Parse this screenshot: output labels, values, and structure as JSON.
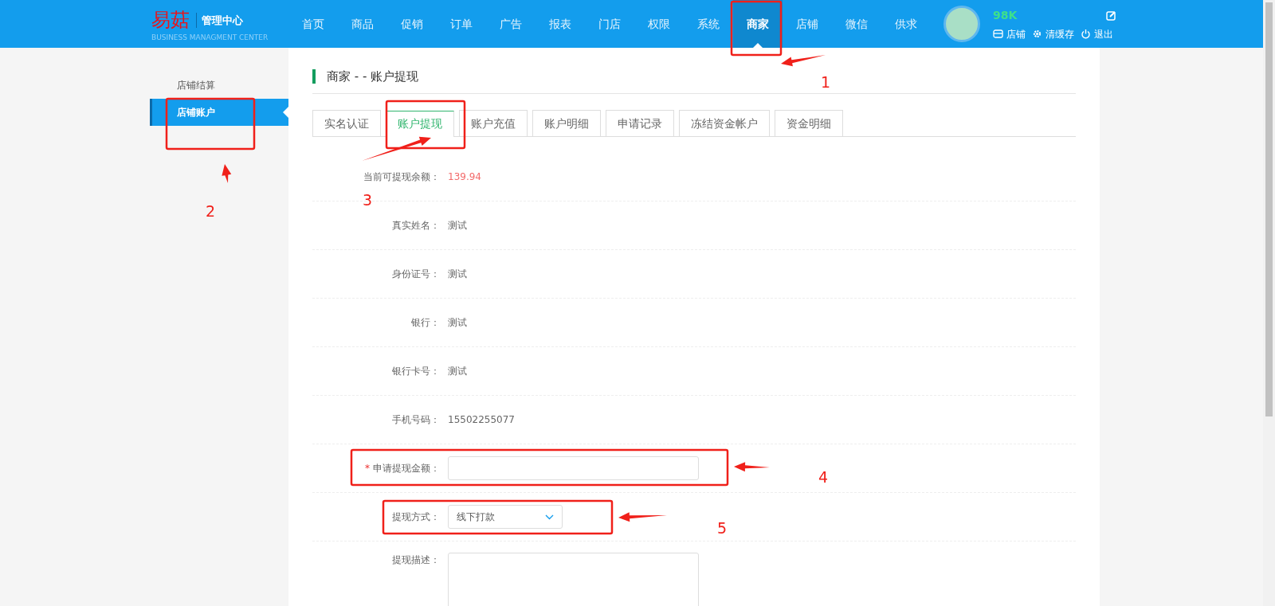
{
  "header": {
    "logo": "易菇",
    "title": "管理中心",
    "subtitle": "BUSINESS MANAGMENT CENTER",
    "nav": [
      {
        "label": "首页",
        "selected": false
      },
      {
        "label": "商品",
        "selected": false
      },
      {
        "label": "促销",
        "selected": false
      },
      {
        "label": "订单",
        "selected": false
      },
      {
        "label": "广告",
        "selected": false
      },
      {
        "label": "报表",
        "selected": false
      },
      {
        "label": "门店",
        "selected": false
      },
      {
        "label": "权限",
        "selected": false
      },
      {
        "label": "系统",
        "selected": false
      },
      {
        "label": "商家",
        "selected": true
      },
      {
        "label": "店铺",
        "selected": false
      },
      {
        "label": "微信",
        "selected": false
      },
      {
        "label": "供求",
        "selected": false
      }
    ],
    "user": "98K",
    "links": [
      {
        "label": "店铺",
        "kind": "shop"
      },
      {
        "label": "清缓存",
        "kind": "gear"
      },
      {
        "label": "退出",
        "kind": "power"
      }
    ]
  },
  "sidebar": {
    "items": [
      {
        "label": "店铺结算",
        "selected": false
      },
      {
        "label": "店铺账户",
        "selected": true
      }
    ]
  },
  "page_title": "商家 - - 账户提现",
  "tabs": [
    {
      "label": "实名认证",
      "selected": false
    },
    {
      "label": "账户提现",
      "selected": true
    },
    {
      "label": "账户充值",
      "selected": false
    },
    {
      "label": "账户明细",
      "selected": false
    },
    {
      "label": "申请记录",
      "selected": false
    },
    {
      "label": "冻结资金帐户",
      "selected": false
    },
    {
      "label": "资金明细",
      "selected": false
    }
  ],
  "form": [
    {
      "kind": "amount",
      "label": "当前可提现余额：",
      "value": "139.94"
    },
    {
      "kind": "text",
      "label": "真实姓名：",
      "value": "测试"
    },
    {
      "kind": "text",
      "label": "身份证号：",
      "value": "测试"
    },
    {
      "kind": "text",
      "label": "银行：",
      "value": "测试"
    },
    {
      "kind": "text",
      "label": "银行卡号：",
      "value": "测试"
    },
    {
      "kind": "text",
      "label": "手机号码：",
      "value": "15502255077"
    },
    {
      "kind": "input",
      "label": "申请提现金额：",
      "required_mark": "*"
    },
    {
      "kind": "select",
      "label": "提现方式：",
      "value": "线下打款"
    },
    {
      "kind": "textarea",
      "label": "提现描述："
    }
  ],
  "annotations": [
    {
      "label": "1"
    },
    {
      "label": "2"
    },
    {
      "label": "3"
    },
    {
      "label": "4"
    },
    {
      "label": "5"
    }
  ]
}
